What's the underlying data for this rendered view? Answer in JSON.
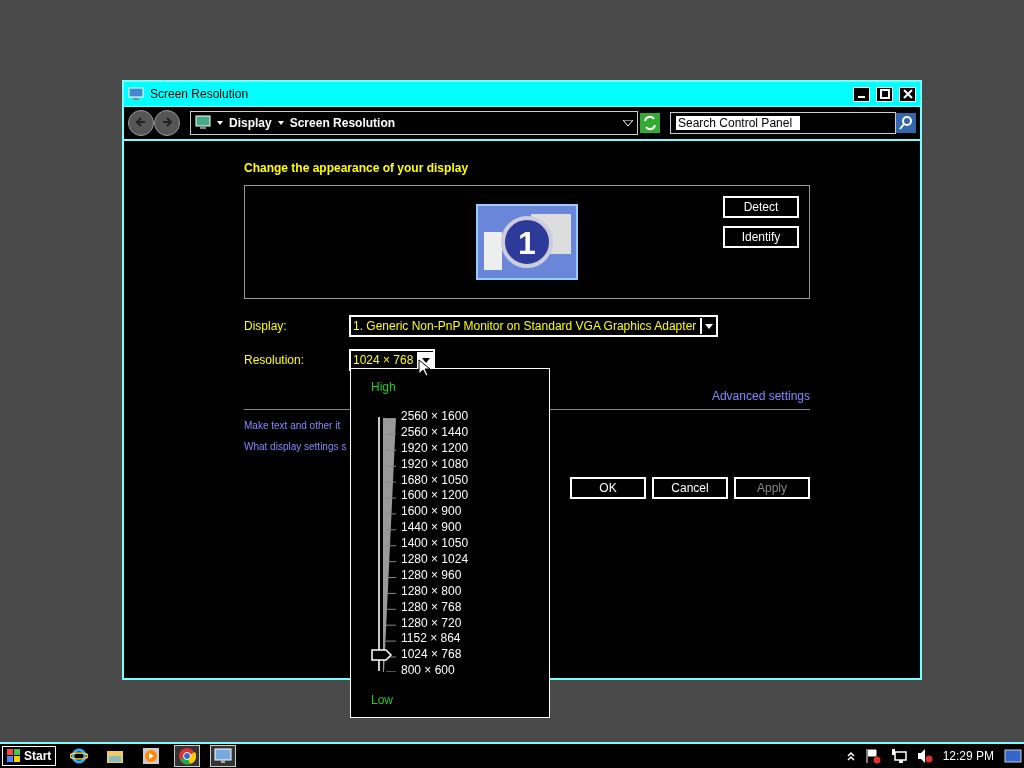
{
  "window": {
    "title": "Screen Resolution"
  },
  "address_bar": {
    "breadcrumbs": [
      "Display",
      "Screen Resolution"
    ],
    "search": {
      "placeholder": "Search Control Panel"
    }
  },
  "heading": "Change the appearance of your display",
  "monitor_preview": {
    "number": "1"
  },
  "preview_buttons": [
    "Detect",
    "Identify"
  ],
  "display": {
    "label": "Display:",
    "value": "1. Generic Non-PnP Monitor on Standard VGA Graphics Adapter"
  },
  "resolution": {
    "label": "Resolution:",
    "value": "1024 × 768",
    "expanded": true
  },
  "advanced_link": "Advanced settings",
  "links": [
    "Make text and other it",
    "What display settings s"
  ],
  "buttons": [
    {
      "label": "OK",
      "disabled": false
    },
    {
      "label": "Cancel",
      "disabled": false
    },
    {
      "label": "Apply",
      "disabled": true
    }
  ],
  "resolution_menu": {
    "high_label": "High",
    "low_label": "Low",
    "level": 0.0625,
    "options": [
      "2560 × 1600",
      "2560 × 1440",
      "1920 × 1200",
      "1920 × 1080",
      "1680 × 1050",
      "1600 × 1200",
      "1600 × 900",
      "1440 × 900",
      "1400 × 1050",
      "1280 × 1024",
      "1280 × 960",
      "1280 × 800",
      "1280 × 768",
      "1280 × 720",
      "1152 × 864",
      "1024 × 768",
      "800 × 600"
    ]
  },
  "taskbar": {
    "start": "Start",
    "apps": [
      {
        "kind": "ie",
        "active": false
      },
      {
        "kind": "folder",
        "active": false
      },
      {
        "kind": "media",
        "active": false
      },
      {
        "kind": "chrome",
        "active": true
      },
      {
        "kind": "control",
        "active": true
      }
    ],
    "clock": "12:29 PM"
  }
}
